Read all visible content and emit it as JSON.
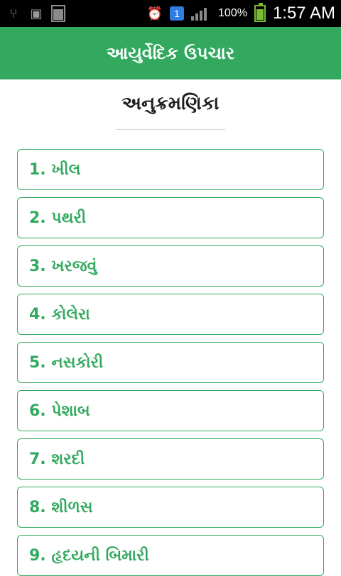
{
  "status_bar": {
    "battery_percent": "100%",
    "time": "1:57 AM",
    "notification_count": "1"
  },
  "app_bar": {
    "title": "આયુર્વેદિક ઉપચાર"
  },
  "content": {
    "heading": "અનુક્રમણિકા",
    "items": [
      {
        "label": "1. ખીલ"
      },
      {
        "label": "2. પથરી"
      },
      {
        "label": "3. ખરજવું"
      },
      {
        "label": "4. કોલેરા"
      },
      {
        "label": "5. નસકોરી"
      },
      {
        "label": "6. પેશાબ"
      },
      {
        "label": "7. શરદી"
      },
      {
        "label": "8. શીળસ"
      },
      {
        "label": "9. હૃદયની બિમારી"
      }
    ]
  }
}
